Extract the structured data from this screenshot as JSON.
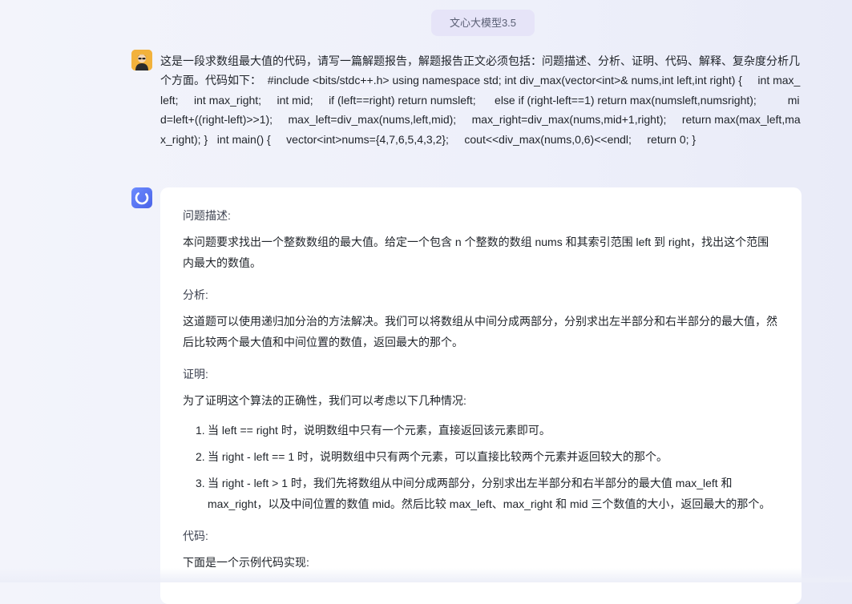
{
  "header": {
    "model_name": "文心大模型3.5"
  },
  "conversation": {
    "user_message": "这是一段求数组最大值的代码，请写一篇解题报告，解题报告正文必须包括：问题描述、分析、证明、代码、解释、复杂度分析几个方面。代码如下：  #include <bits/stdc++.h> using namespace std; int div_max(vector<int>& nums,int left,int right) {     int max_left;     int max_right;     int mid;     if (left==right) return numsleft;      else if (right-left==1) return max(numsleft,numsright);          mid=left+((right-left)>>1);     max_left=div_max(nums,left,mid);     max_right=div_max(nums,mid+1,right);     return max(max_left,max_right); }   int main() {     vector<int>nums={4,7,6,5,4,3,2};     cout<<div_max(nums,0,6)<<endl;     return 0; }",
    "reply": {
      "problem_heading": "问题描述:",
      "problem_text": "本问题要求找出一个整数数组的最大值。给定一个包含 n 个整数的数组 nums 和其索引范围 left 到 right，找出这个范围内最大的数值。",
      "analysis_heading": "分析:",
      "analysis_text": "这道题可以使用递归加分治的方法解决。我们可以将数组从中间分成两部分，分别求出左半部分和右半部分的最大值，然后比较两个最大值和中间位置的数值，返回最大的那个。",
      "proof_heading": "证明:",
      "proof_text": "为了证明这个算法的正确性，我们可以考虑以下几种情况:",
      "proof_steps": [
        {
          "num": "1.",
          "text": "当 left == right 时，说明数组中只有一个元素，直接返回该元素即可。"
        },
        {
          "num": "2.",
          "text": "当 right - left == 1 时，说明数组中只有两个元素，可以直接比较两个元素并返回较大的那个。"
        },
        {
          "num": "3.",
          "text": "当 right - left > 1 时，我们先将数组从中间分成两部分，分别求出左半部分和右半部分的最大值 max_left 和 max_right，以及中间位置的数值 mid。然后比较 max_left、max_right 和 mid 三个数值的大小，返回最大的那个。"
        }
      ],
      "code_heading": "代码:",
      "code_intro": "下面是一个示例代码实现:"
    }
  },
  "icons": {
    "user_avatar": "user-avatar-icon",
    "bot_avatar": "ernie-bot-icon"
  },
  "colors": {
    "accent": "#5b73ef",
    "pill_bg": "#e6e4f8",
    "avatar_yellow": "#f2b23c"
  }
}
